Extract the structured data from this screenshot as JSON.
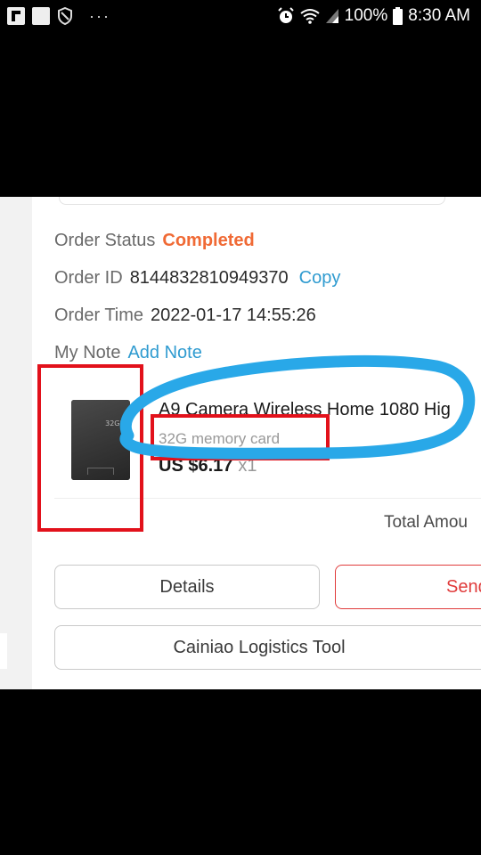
{
  "status_bar": {
    "battery": "100%",
    "time": "8:30 AM",
    "more_dots": "···"
  },
  "order": {
    "status_label": "Order Status",
    "status_value": "Completed",
    "id_label": "Order ID",
    "id_value": "8144832810949370",
    "copy_label": "Copy",
    "time_label": "Order Time",
    "time_value": "2022-01-17 14:55:26",
    "note_label": "My Note",
    "add_note_label": "Add Note"
  },
  "product": {
    "title": "A9 Camera Wireless Home 1080 Hig",
    "variant": "32G memory card",
    "price": "US $6.17",
    "quantity": "x1",
    "thumb_text": "32GB"
  },
  "summary": {
    "total_label": "Total Amou"
  },
  "buttons": {
    "details": "Details",
    "send": "Send",
    "logistics": "Cainiao Logistics Tool"
  },
  "colors": {
    "status_completed": "#f06a35",
    "link": "#2f9bd0",
    "annotation_red": "#e2111b",
    "annotation_blue": "#29a8e8"
  }
}
